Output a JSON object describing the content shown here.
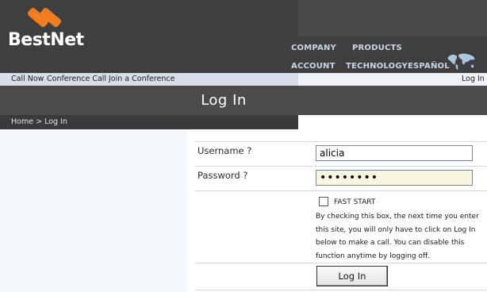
{
  "brand": {
    "name": "BestNet",
    "accent": "#f07d22"
  },
  "topnav": {
    "company": "COMPANY",
    "products": "PRODUCTS",
    "account": "ACCOUNT",
    "technology": "TECHNOLOGY",
    "espanol": "ESPAÑOL",
    "icon": "world-map-icon"
  },
  "subnav": {
    "call_now": "Call Now",
    "conference_call": "Conference Call",
    "join_conference": "Join a Conference",
    "login": "Log In"
  },
  "page": {
    "title": "Log In"
  },
  "breadcrumb": {
    "home": "Home",
    "separator": ">",
    "current": "Log In"
  },
  "form": {
    "username_label": "Username",
    "password_label": "Password",
    "help_mark": "?",
    "username_value": "alicia",
    "password_value": "••••••••",
    "fast_start_label": "FAST START",
    "fast_start_checked": false,
    "fast_start_description": "By checking this box, the next time you enter this site, you will only have to click on Log In below to make a call. You can disable this function anytime by logging off.",
    "submit_label": "Log In"
  }
}
